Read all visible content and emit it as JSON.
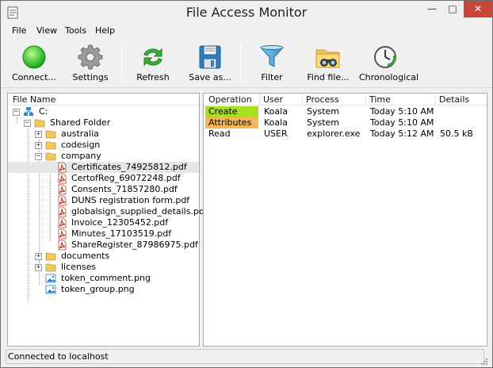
{
  "window": {
    "title": "File Access Monitor",
    "minimize": "—",
    "maximize": "□",
    "close": "✕"
  },
  "menu": [
    "File",
    "View",
    "Tools",
    "Help"
  ],
  "toolbar": {
    "connect": "Connect...",
    "settings": "Settings",
    "refresh": "Refresh",
    "save_as": "Save as...",
    "filter": "Filter",
    "find_file": "Find file...",
    "chronological": "Chronological"
  },
  "tree": {
    "header": "File Name",
    "root": "C:",
    "shared": "Shared Folder",
    "folders": [
      "australia",
      "codesign",
      "company"
    ],
    "company_files": [
      "Certificates_74925812.pdf",
      "CertofReg_69072248.pdf",
      "Consents_71857280.pdf",
      "DUNS registration form.pdf",
      "globalsign_supplied_details.pdf",
      "Invoice_12305452.pdf",
      "Minutes_17103519.pdf",
      "ShareRegister_87986975.pdf"
    ],
    "more_folders": [
      "documents",
      "licenses"
    ],
    "loose_files": [
      "token_comment.png",
      "token_group.png"
    ]
  },
  "log": {
    "headers": {
      "operation": "Operation",
      "user": "User",
      "process": "Process",
      "time": "Time",
      "details": "Details"
    },
    "rows": [
      {
        "operation": "Create",
        "user": "Koala",
        "process": "System",
        "time": "Today 5:10 AM",
        "details": "",
        "color": "#a6e01c"
      },
      {
        "operation": "Attributes",
        "user": "Koala",
        "process": "System",
        "time": "Today 5:10 AM",
        "details": "",
        "color": "#f7b552"
      },
      {
        "operation": "Read",
        "user": "USER",
        "process": "explorer.exe",
        "time": "Today 5:12 AM",
        "details": "50.5 kB",
        "color": ""
      }
    ]
  },
  "status": "Connected to localhost",
  "colors": {
    "create": "#a6e01c",
    "attributes": "#f7b552",
    "close": "#c7463a",
    "selection": "#e6e6e6"
  }
}
